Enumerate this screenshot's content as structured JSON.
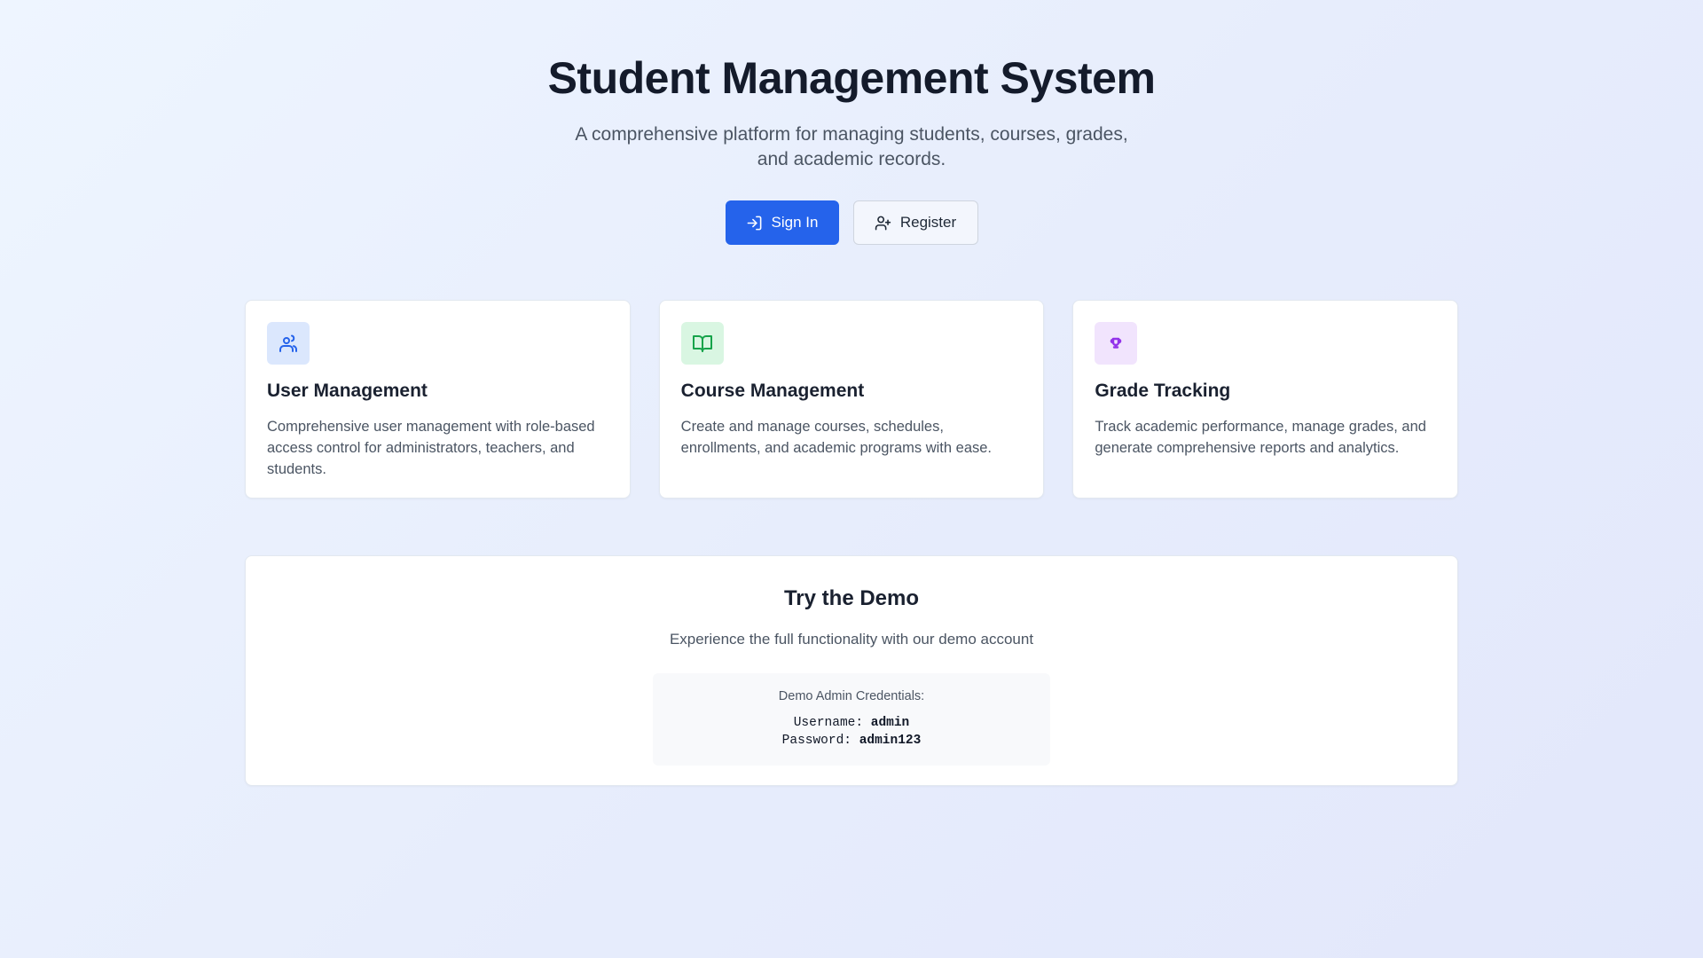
{
  "hero": {
    "title": "Student Management System",
    "subtitle": "A comprehensive platform for managing students, courses, grades, and academic records.",
    "sign_in_label": "Sign In",
    "register_label": "Register"
  },
  "colors": {
    "primary": "#2563eb",
    "blue_tint": "#dbe7fd",
    "green_tint": "#d9f6e2",
    "purple_tint": "#f1e4fd"
  },
  "features": [
    {
      "icon": "users-icon",
      "title": "User Management",
      "description": "Comprehensive user management with role-based access control for administrators, teachers, and students."
    },
    {
      "icon": "book-open-icon",
      "title": "Course Management",
      "description": "Create and manage courses, schedules, enrollments, and academic programs with ease."
    },
    {
      "icon": "award-icon",
      "title": "Grade Tracking",
      "description": "Track academic performance, manage grades, and generate comprehensive reports and analytics."
    }
  ],
  "demo": {
    "title": "Try the Demo",
    "subtitle": "Experience the full functionality with our demo account",
    "credentials_title": "Demo Admin Credentials:",
    "username_label": "Username:",
    "username_value": "admin",
    "password_label": "Password:",
    "password_value": "admin123"
  }
}
